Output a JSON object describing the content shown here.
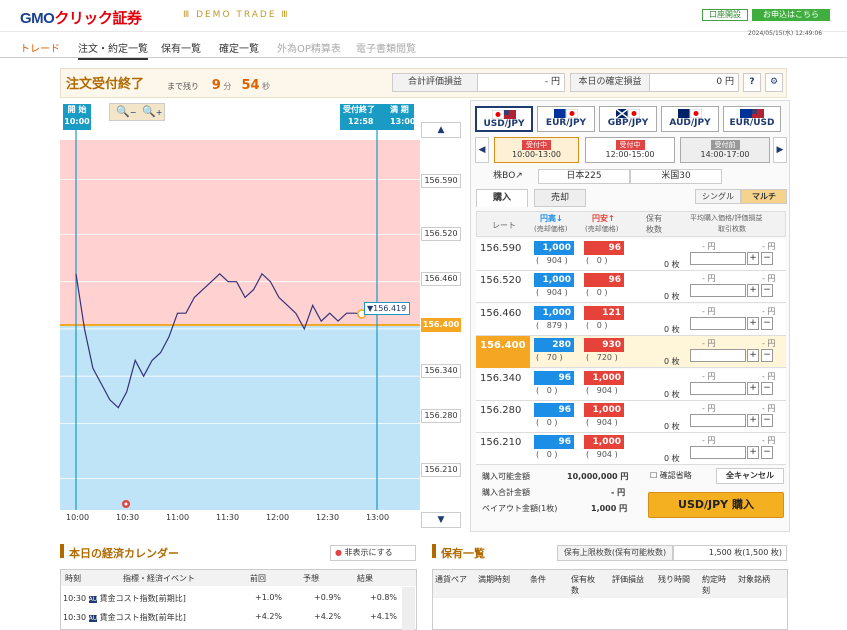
{
  "header": {
    "logo_gmo": "GMO",
    "logo_rest": "クリック証券",
    "demo": "Ⅲ DEMO TRADE Ⅲ",
    "open_account": "口座開設",
    "apply": "お申込はこちら",
    "datetime": "2024/05/15(水) 12:49:06"
  },
  "nav": [
    "トレード",
    "注文・約定一覧",
    "保有一覧",
    "確定一覧",
    "外為OP精算表",
    "電子書類閲覧"
  ],
  "status": {
    "order_end": "注文受付終了",
    "remain_label": "まで残り",
    "minutes": "9",
    "min_unit": "分",
    "seconds": "54",
    "sec_unit": "秒",
    "total_pl_label": "合計評価損益",
    "total_pl_value": "- 円",
    "today_label": "本日の確定損益",
    "today_value": "0 円",
    "help": "?",
    "gear": "⚙"
  },
  "chart": {
    "open_label": "開 始",
    "open_time": "10:00",
    "close_label": "受付終了",
    "close_time": "12:58",
    "expiry_label": "満 期",
    "expiry_time": "13:00",
    "current_rate": "156.419",
    "ticks": [
      "156.590",
      "156.520",
      "156.460",
      "156.400",
      "156.340",
      "156.280",
      "156.210"
    ],
    "current_tick": "156.400",
    "xlabels": [
      "10:00",
      "10:30",
      "11:00",
      "11:30",
      "12:00",
      "12:30",
      "13:00"
    ],
    "zoom_out": "−",
    "zoom_in": "+",
    "up": "▲",
    "down": "▼"
  },
  "chart_data": {
    "type": "line",
    "ylim": [
      156.17,
      156.64
    ],
    "y_ticks": [
      156.59,
      156.52,
      156.46,
      156.4,
      156.34,
      156.28,
      156.21
    ],
    "target": 156.4,
    "x": [
      "10:00",
      "10:05",
      "10:10",
      "10:15",
      "10:20",
      "10:25",
      "10:30",
      "10:35",
      "10:40",
      "10:45",
      "10:50",
      "10:55",
      "11:00",
      "11:05",
      "11:10",
      "11:15",
      "11:20",
      "11:25",
      "11:30",
      "11:35",
      "11:40",
      "11:45",
      "11:50",
      "11:55",
      "12:00",
      "12:05",
      "12:10",
      "12:15",
      "12:20",
      "12:25",
      "12:30",
      "12:35",
      "12:40",
      "12:45",
      "12:49"
    ],
    "values": [
      156.47,
      156.4,
      156.35,
      156.33,
      156.31,
      156.3,
      156.32,
      156.36,
      156.34,
      156.36,
      156.37,
      156.39,
      156.42,
      156.42,
      156.44,
      156.45,
      156.46,
      156.47,
      156.46,
      156.46,
      156.44,
      156.45,
      156.47,
      156.46,
      156.44,
      156.43,
      156.42,
      156.4,
      156.43,
      156.41,
      156.42,
      156.41,
      156.42,
      156.42,
      156.419
    ]
  },
  "pairs": [
    {
      "name": "USD/JPY"
    },
    {
      "name": "EUR/JPY"
    },
    {
      "name": "GBP/JPY"
    },
    {
      "name": "AUD/JPY"
    },
    {
      "name": "EUR/USD"
    }
  ],
  "sessions": [
    {
      "tag": "受付中",
      "time": "10:00-13:00"
    },
    {
      "tag": "受付中",
      "time": "12:00-15:00"
    },
    {
      "tag": "受付前",
      "time": "14:00-17:00"
    }
  ],
  "products": [
    "株BO↗",
    "日本225",
    "米国30"
  ],
  "tabs": {
    "buy": "購入",
    "sell": "売却",
    "single": "シングル",
    "multi": "マルチ"
  },
  "cols": {
    "rate": "レート",
    "high": "円高↓",
    "high_sub": "(売却価格)",
    "low": "円安↑",
    "low_sub": "(売却価格)",
    "hold": "保有",
    "hold_sub": "枚数",
    "avg": "平均購入価格/評価損益",
    "avg_sub": "取引枚数"
  },
  "rows": [
    {
      "rate": "156.590",
      "b": "1,000",
      "bs": "904",
      "s": "96",
      "ss": "0",
      "qty": "0 枚"
    },
    {
      "rate": "156.520",
      "b": "1,000",
      "bs": "904",
      "s": "96",
      "ss": "0",
      "qty": "0 枚"
    },
    {
      "rate": "156.460",
      "b": "1,000",
      "bs": "879",
      "s": "121",
      "ss": "0",
      "qty": "0 枚"
    },
    {
      "rate": "156.400",
      "b": "280",
      "bs": "70",
      "s": "930",
      "ss": "720",
      "qty": "0 枚"
    },
    {
      "rate": "156.340",
      "b": "96",
      "bs": "0",
      "s": "1,000",
      "ss": "904",
      "qty": "0 枚"
    },
    {
      "rate": "156.280",
      "b": "96",
      "bs": "0",
      "s": "1,000",
      "ss": "904",
      "qty": "0 枚"
    },
    {
      "rate": "156.210",
      "b": "96",
      "bs": "0",
      "s": "1,000",
      "ss": "904",
      "qty": "0 枚"
    }
  ],
  "yen": "- 円",
  "yen2": "- 円",
  "summary": {
    "avail_label": "購入可能金額",
    "avail": "10,000,000 円",
    "total_label": "購入合計金額",
    "total": "- 円",
    "payout_label": "ペイアウト金額(1枚)",
    "payout": "1,000 円",
    "confirm": "確認省略",
    "cancel_all": "全キャンセル",
    "buy_btn": "USD/JPY 購入"
  },
  "calendar": {
    "title": "本日の経済カレンダー",
    "hide": "非表示にする",
    "cols": [
      "時刻",
      "指標・経済イベント",
      "前回",
      "予想",
      "結果"
    ],
    "rows": [
      {
        "time": "10:30",
        "name": "賃金コスト指数[前期比]",
        "prev": "+1.0%",
        "fc": "+0.9%",
        "res": "+0.8%"
      },
      {
        "time": "10:30",
        "name": "賃金コスト指数[前年比]",
        "prev": "+4.2%",
        "fc": "+4.2%",
        "res": "+4.1%"
      }
    ]
  },
  "holdings": {
    "title": "保有一覧",
    "limit_label": "保有上限枚数(保有可能枚数)",
    "limit": "1,500 枚(1,500 枚)",
    "cols": [
      "通貨ペア",
      "満期時刻",
      "条件",
      "保有枚数",
      "評価損益",
      "残り時間",
      "約定時刻",
      "対象銘柄"
    ]
  }
}
